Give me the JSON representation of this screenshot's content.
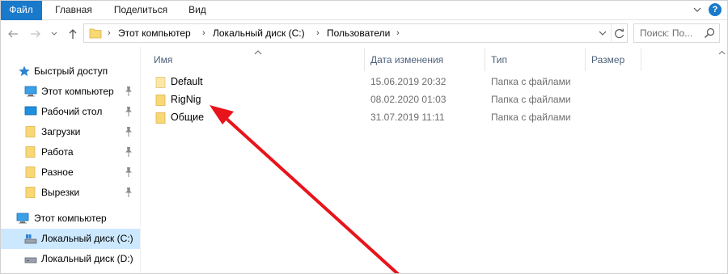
{
  "ribbon": {
    "tabs": [
      "Файл",
      "Главная",
      "Поделиться",
      "Вид"
    ]
  },
  "address": {
    "breadcrumbs": [
      "Этот компьютер",
      "Локальный диск (C:)",
      "Пользователи"
    ]
  },
  "search": {
    "placeholder": "Поиск: По..."
  },
  "sidebar": {
    "quick_access": "Быстрый доступ",
    "items": [
      {
        "label": "Этот компьютер",
        "icon": "computer-icon",
        "pinned": true
      },
      {
        "label": "Рабочий стол",
        "icon": "desktop-icon",
        "pinned": true
      },
      {
        "label": "Загрузки",
        "icon": "folder-icon",
        "pinned": true
      },
      {
        "label": "Работа",
        "icon": "folder-icon",
        "pinned": true
      },
      {
        "label": "Разное",
        "icon": "folder-icon",
        "pinned": true
      },
      {
        "label": "Вырезки",
        "icon": "folder-icon",
        "pinned": true
      }
    ],
    "this_pc": "Этот компьютер",
    "drives": [
      {
        "label": "Локальный диск (C:)",
        "selected": true
      },
      {
        "label": "Локальный диск (D:)",
        "selected": false
      }
    ]
  },
  "columns": {
    "name": "Имя",
    "date": "Дата изменения",
    "type": "Тип",
    "size": "Размер"
  },
  "files": [
    {
      "name": "Default",
      "date": "15.06.2019 20:32",
      "type": "Папка с файлами"
    },
    {
      "name": "RigNig",
      "date": "08.02.2020 01:03",
      "type": "Папка с файлами"
    },
    {
      "name": "Общие",
      "date": "31.07.2019 11:11",
      "type": "Папка с файлами"
    }
  ],
  "colors": {
    "accent": "#1979ca",
    "selection": "#cce8ff",
    "folder": "#f8d775",
    "annotation_arrow": "#e8141b"
  }
}
